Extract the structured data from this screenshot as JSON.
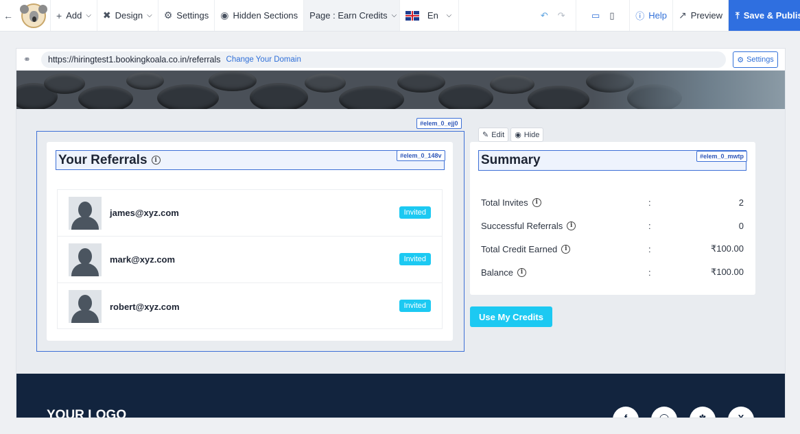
{
  "toolbar": {
    "add_label": "Add",
    "design_label": "Design",
    "settings_label": "Settings",
    "hidden_sections_label": "Hidden Sections",
    "page_prefix": "Page :",
    "page_value": "Earn Credits",
    "language": "En",
    "help_label": "Help",
    "preview_label": "Preview",
    "publish_label": "Save & Publish"
  },
  "urlbar": {
    "url": "https://hiringtest1.bookingkoala.co.in/referrals",
    "change_domain": "Change Your Domain",
    "settings_label": "Settings"
  },
  "tags": {
    "section": "#elem_0_ejj0",
    "referrals_header": "#elem_0_148v",
    "summary_header": "#elem_0_mwtp"
  },
  "referrals": {
    "title": "Your Referrals",
    "items": [
      {
        "email": "james@xyz.com",
        "status": "Invited"
      },
      {
        "email": "mark@xyz.com",
        "status": "Invited"
      },
      {
        "email": "robert@xyz.com",
        "status": "Invited"
      }
    ]
  },
  "summary": {
    "edit_label": "Edit",
    "hide_label": "Hide",
    "title": "Summary",
    "rows": [
      {
        "label": "Total Invites",
        "colon": ":",
        "value": "2"
      },
      {
        "label": "Successful Referrals",
        "colon": ":",
        "value": "0"
      },
      {
        "label": "Total Credit Earned",
        "colon": ":",
        "value": "₹100.00"
      },
      {
        "label": "Balance",
        "colon": ":",
        "value": "₹100.00"
      }
    ],
    "use_credits_label": "Use My Credits"
  },
  "footer": {
    "logo_text": "YOUR LOGO",
    "social": [
      "facebook-icon",
      "instagram-icon",
      "yelp-icon",
      "x-icon"
    ]
  },
  "colors": {
    "accent": "#2f6fe0",
    "badge": "#1cc9f2",
    "footer": "#12243e"
  }
}
